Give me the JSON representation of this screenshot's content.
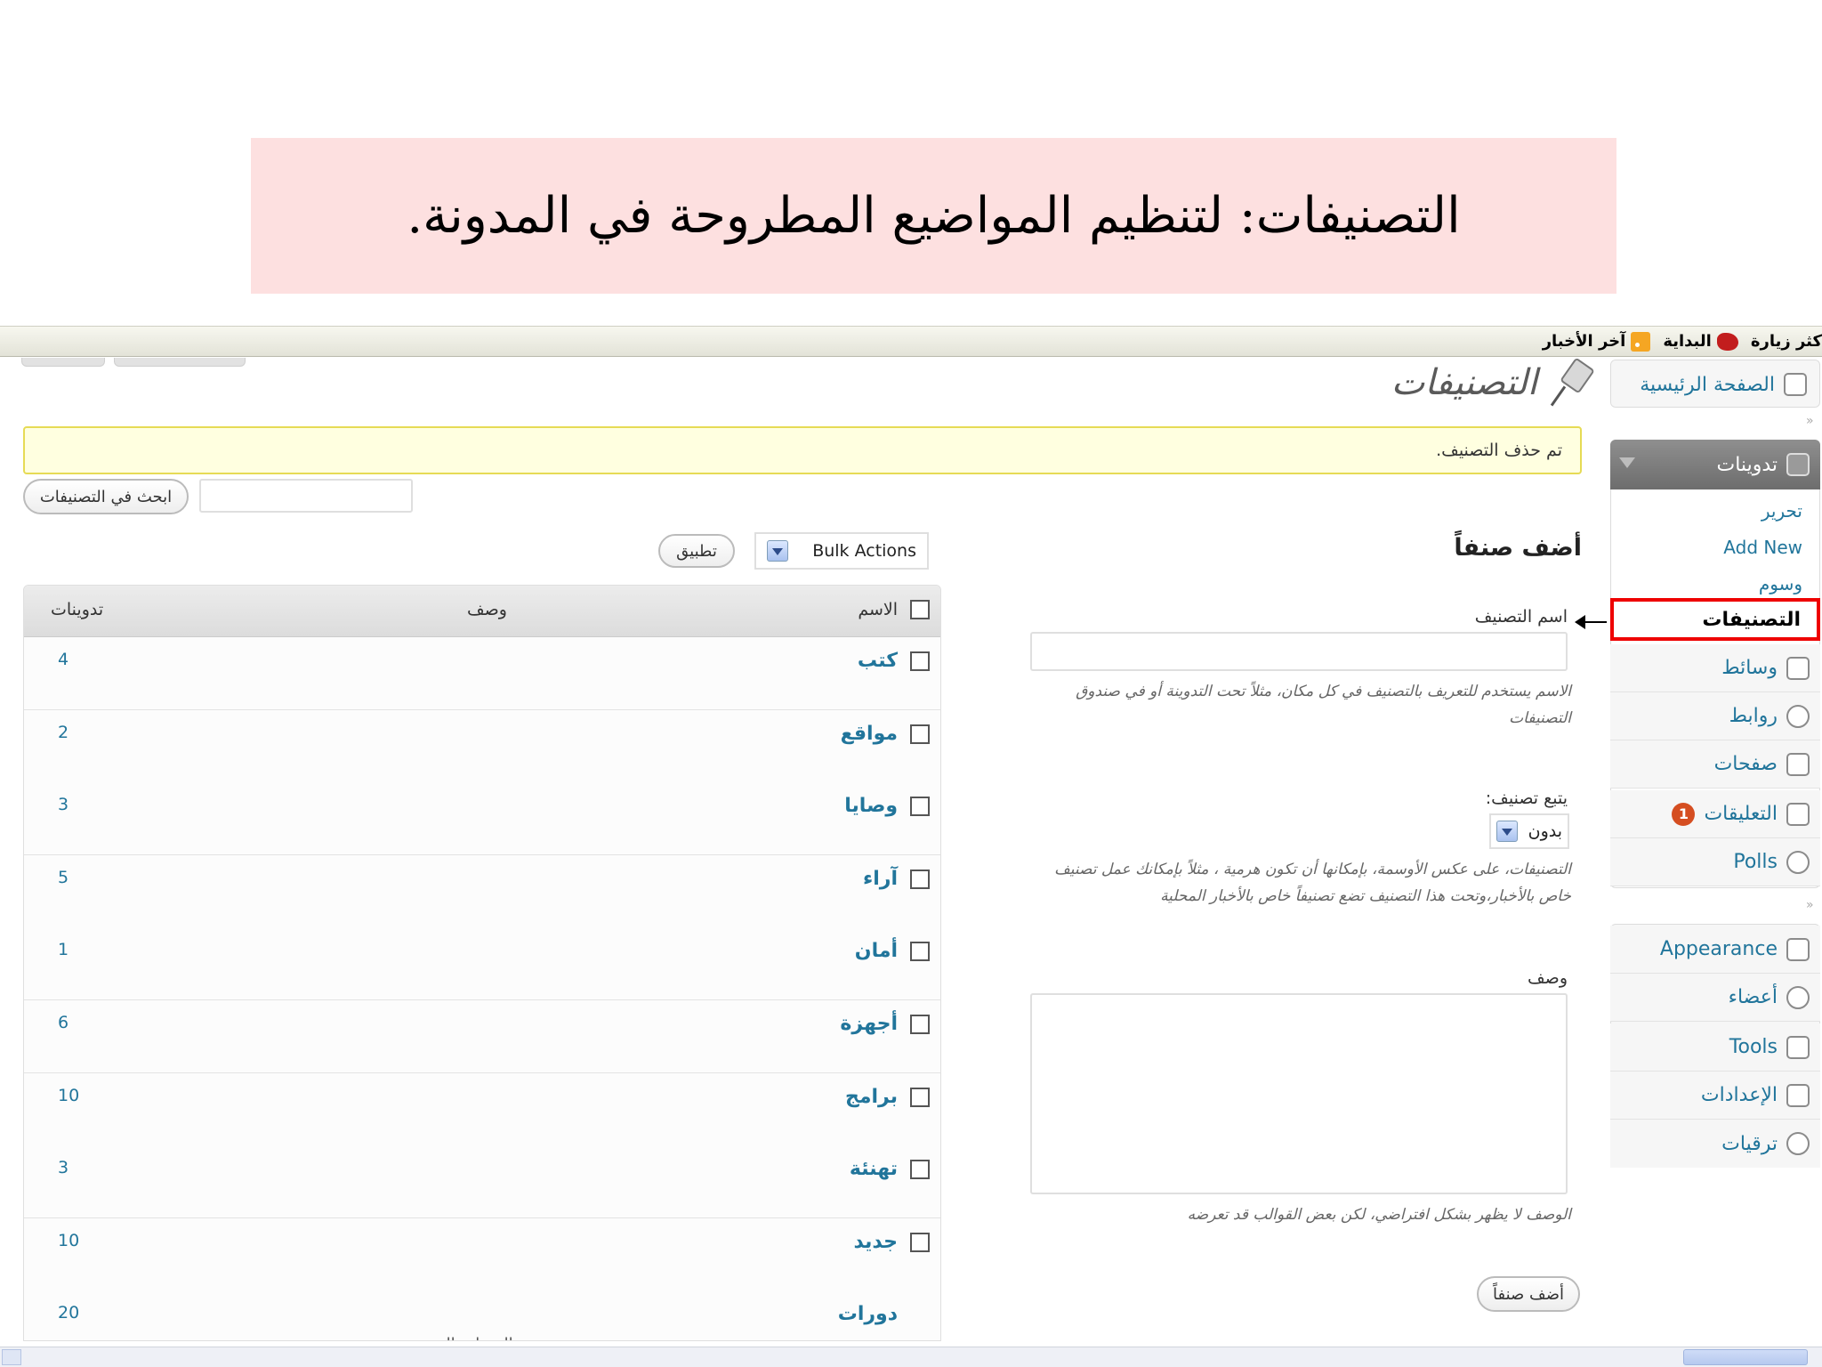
{
  "banner": {
    "title": "التصنيفات: لتنظيم المواضيع المطروحة في المدونة."
  },
  "bookmarks": {
    "items": [
      "كثر زيارة",
      "البداية",
      "آخر الأخبار"
    ]
  },
  "sidebar": {
    "dashboard": "الصفحة الرئيسية",
    "posts": "تدوينات",
    "posts_sub": [
      "تحرير",
      "Add New",
      "وسوم",
      "التصنيفات"
    ],
    "menu": [
      "وسائط",
      "روابط",
      "صفحات",
      "التعليقات",
      "Polls"
    ],
    "comments_badge": "1",
    "menu2": [
      "Appearance",
      "أعضاء",
      "Tools",
      "الإعدادات",
      "ترقيات"
    ]
  },
  "page": {
    "title": "التصنيفات",
    "notice": "تم حذف التصنيف."
  },
  "search": {
    "button": "ابحث في التصنيفات",
    "value": ""
  },
  "bulk": {
    "selected": "Bulk Actions",
    "apply": "تطبيق"
  },
  "form": {
    "heading": "أضف صنفاً",
    "name_label": "اسم التصنيف",
    "name_value": "",
    "name_hint_1": "الاسم يستخدم للتعريف بالتصنيف في كل مكان، مثلاً تحت التدوينة أو في صندوق",
    "name_hint_2": "التصنيفات",
    "parent_label": "يتبع تصنيف:",
    "parent_selected": "بدون",
    "parent_hint_1": "التصنيفات، على عكس الأوسمة، بإمكانها أن تكون هرمية ، مثلاً بإمكانك عمل تصنيف",
    "parent_hint_2": "خاص بالأخبار،وتحت هذا التصنيف تضع تصنيفاً خاص بالأخبار المحلية",
    "desc_label": "وصف",
    "desc_value": "",
    "desc_hint": "الوصف لا يظهر بشكل افتراضي، لكن بعض القوالب قد تعرضه",
    "submit": "أضف صنفاً"
  },
  "table": {
    "columns": {
      "name": "الاسم",
      "description": "وصف",
      "posts": "تدوينات"
    },
    "rows": [
      {
        "name": "كتب",
        "description": "",
        "posts": "4"
      },
      {
        "name": "مواقع",
        "description": "",
        "posts": "2"
      },
      {
        "name": "وصايا",
        "description": "",
        "posts": "3"
      },
      {
        "name": "آراء",
        "description": "",
        "posts": "5"
      },
      {
        "name": "أمان",
        "description": "",
        "posts": "1"
      },
      {
        "name": "أجهزة",
        "description": "",
        "posts": "6"
      },
      {
        "name": "برامج",
        "description": "",
        "posts": "10"
      },
      {
        "name": "تهنئة",
        "description": "",
        "posts": "3"
      },
      {
        "name": "جديد",
        "description": "",
        "posts": "10"
      },
      {
        "name": "دورات",
        "description": "الدورات التدريبية",
        "posts": "20"
      }
    ]
  }
}
